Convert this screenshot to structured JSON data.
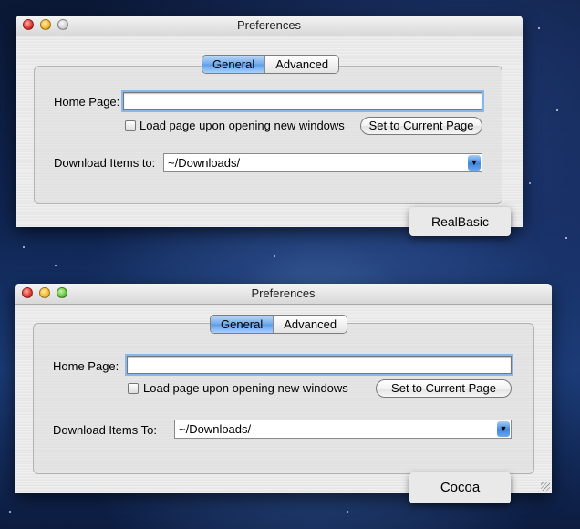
{
  "windows": [
    {
      "title": "Preferences",
      "tabs": [
        "General",
        "Advanced"
      ],
      "active_tab": "General",
      "home_page_label": "Home Page:",
      "home_page_value": "",
      "load_page_checkbox_label": "Load page upon opening new windows",
      "load_page_checked": false,
      "set_current_button": "Set to Current Page",
      "download_label": "Download Items to:",
      "download_value": "~/Downloads/",
      "caption": "RealBasic"
    },
    {
      "title": "Preferences",
      "tabs": [
        "General",
        "Advanced"
      ],
      "active_tab": "General",
      "home_page_label": "Home Page:",
      "home_page_value": "",
      "load_page_checkbox_label": "Load page upon opening new windows",
      "load_page_checked": false,
      "set_current_button": "Set to Current Page",
      "download_label": "Download Items To:",
      "download_value": "~/Downloads/",
      "caption": "Cocoa"
    }
  ],
  "colors": {
    "accent_blue": "#5d9be6",
    "window_bg": "#ececec",
    "desktop_bg": "#0f2450"
  },
  "icons": {
    "close": "close-icon",
    "minimize": "minimize-icon",
    "zoom": "zoom-icon",
    "popup_arrow": "chevron-down-icon",
    "resize": "resize-grip-icon"
  }
}
